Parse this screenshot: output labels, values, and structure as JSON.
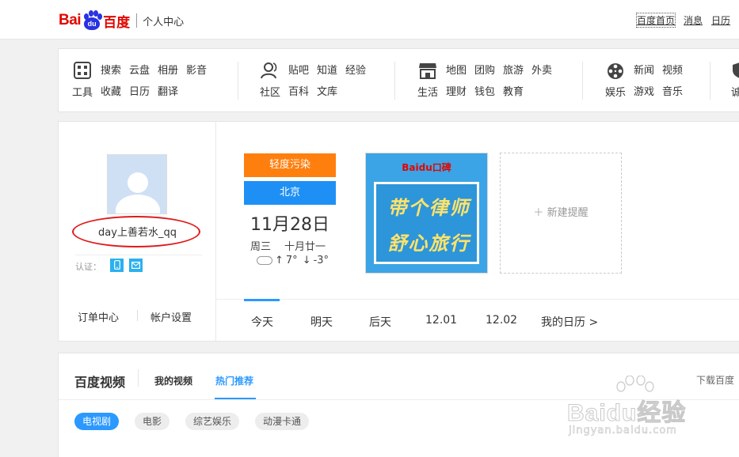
{
  "header": {
    "logo_bai": "Bai",
    "logo_du": "du",
    "logo_cn": "百度",
    "section_title": "个人中心",
    "links": [
      "百度首页",
      "消息",
      "日历"
    ]
  },
  "nav": {
    "groups": [
      {
        "label": "工具",
        "icon": "grid-icon",
        "links": [
          "搜索",
          "云盘",
          "相册",
          "影音",
          "收藏",
          "日历",
          "翻译"
        ]
      },
      {
        "label": "社区",
        "icon": "people-icon",
        "links": [
          "贴吧",
          "知道",
          "经验",
          "百科",
          "文库"
        ]
      },
      {
        "label": "生活",
        "icon": "store-icon",
        "links": [
          "地图",
          "团购",
          "旅游",
          "外卖",
          "理财",
          "钱包",
          "教育"
        ]
      },
      {
        "label": "娱乐",
        "icon": "film-reel-icon",
        "links": [
          "新闻",
          "视频",
          "游戏",
          "音乐"
        ]
      },
      {
        "label": "诚",
        "icon": "shield-icon",
        "links": []
      }
    ]
  },
  "profile": {
    "username": "day上善若水_qq",
    "verify_label": "认证：",
    "verify_icons": [
      "phone-icon",
      "email-icon"
    ],
    "order_center": "订单中心",
    "account_settings": "帐户设置"
  },
  "weather": {
    "pollution": "轻度污染",
    "city": "北京",
    "date": "11月28日",
    "weekday": "周三",
    "lunar": "十月廿一",
    "high": "7°",
    "low": "-3°",
    "colors": {
      "pollution": "#ff7f0e",
      "city": "#1e90f5"
    }
  },
  "ad": {
    "brand": "Baidu口碑",
    "line1": "带个律师",
    "line2": "舒心旅行"
  },
  "reminder": {
    "label": "新建提醒"
  },
  "day_tabs": [
    "今天",
    "明天",
    "后天",
    "12.01",
    "12.02",
    "我的日历 >"
  ],
  "video": {
    "title": "百度视频",
    "tabs": [
      "我的视频",
      "热门推荐"
    ],
    "download": "下载百度",
    "chips": [
      "电视剧",
      "电影",
      "综艺娱乐",
      "动漫卡通"
    ]
  },
  "watermark": {
    "brand": "Baidu经验",
    "url": "jingyan.baidu.com"
  }
}
